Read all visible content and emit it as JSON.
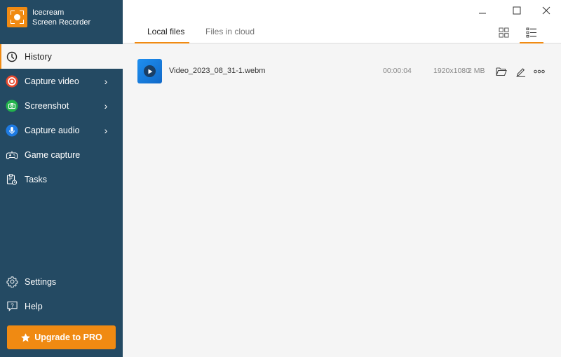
{
  "app": {
    "name_line1": "Icecream",
    "name_line2": "Screen Recorder",
    "logo_icon": "screen-record-logo-icon",
    "accent_color": "#f08a12",
    "sidebar_color": "#244a63"
  },
  "sidebar": {
    "items": [
      {
        "label": "History",
        "icon": "clock-icon",
        "active": true,
        "has_submenu": false
      },
      {
        "label": "Capture video",
        "icon": "record-icon",
        "active": false,
        "has_submenu": true
      },
      {
        "label": "Screenshot",
        "icon": "camera-icon",
        "active": false,
        "has_submenu": true
      },
      {
        "label": "Capture audio",
        "icon": "microphone-icon",
        "active": false,
        "has_submenu": true
      },
      {
        "label": "Game capture",
        "icon": "gamepad-icon",
        "active": false,
        "has_submenu": false
      },
      {
        "label": "Tasks",
        "icon": "tasks-icon",
        "active": false,
        "has_submenu": false
      }
    ],
    "bottom_items": [
      {
        "label": "Settings",
        "icon": "gear-icon"
      },
      {
        "label": "Help",
        "icon": "help-icon"
      }
    ],
    "upgrade_label": "Upgrade to PRO"
  },
  "window_controls": {
    "minimize": "minimize-icon",
    "maximize": "maximize-icon",
    "close": "close-icon"
  },
  "tabs": [
    {
      "label": "Local files",
      "active": true
    },
    {
      "label": "Files in cloud",
      "active": false
    }
  ],
  "view_modes": {
    "grid": "grid-view-icon",
    "list": "list-view-icon",
    "active": "list"
  },
  "files": [
    {
      "name": "Video_2023_08_31-1.webm",
      "duration": "00:00:04",
      "resolution": "1920x1080",
      "size": "2 MB"
    }
  ]
}
